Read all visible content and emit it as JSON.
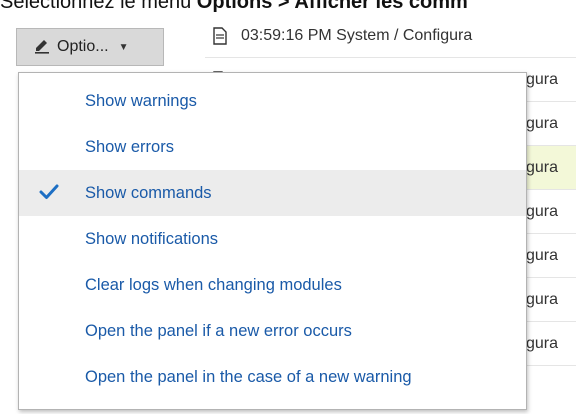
{
  "instruction": {
    "prefix": "Sélectionnez le menu ",
    "bold": "Options > Afficher les comm"
  },
  "options_button": {
    "label": "Optio...",
    "pencil_icon": "pencil-icon",
    "caret_icon": "caret-down-icon"
  },
  "log": {
    "rows": [
      {
        "text": "03:59:16 PM System / Configura",
        "tail": ""
      },
      {
        "text": "",
        "tail": "figura"
      },
      {
        "text": "",
        "tail": "figura"
      },
      {
        "text": "",
        "tail": "figura"
      },
      {
        "text": "",
        "tail": "figura"
      },
      {
        "text": "",
        "tail": "figura"
      },
      {
        "text": "",
        "tail": "figura"
      },
      {
        "text": "",
        "tail": "figura"
      }
    ]
  },
  "menu": {
    "items": [
      {
        "label": "Show warnings",
        "checked": false
      },
      {
        "label": "Show errors",
        "checked": false
      },
      {
        "label": "Show commands",
        "checked": true
      },
      {
        "label": "Show notifications",
        "checked": false
      },
      {
        "label": "Clear logs when changing modules",
        "checked": false
      },
      {
        "label": "Open the panel if a new error occurs",
        "checked": false
      },
      {
        "label": "Open the panel in the case of a new warning",
        "checked": false
      }
    ]
  },
  "colors": {
    "menu_text": "#1a5aa8",
    "check": "#1d6fc4",
    "highlight_row": "#f3f8d8",
    "button_bg": "#d9d9d9"
  }
}
